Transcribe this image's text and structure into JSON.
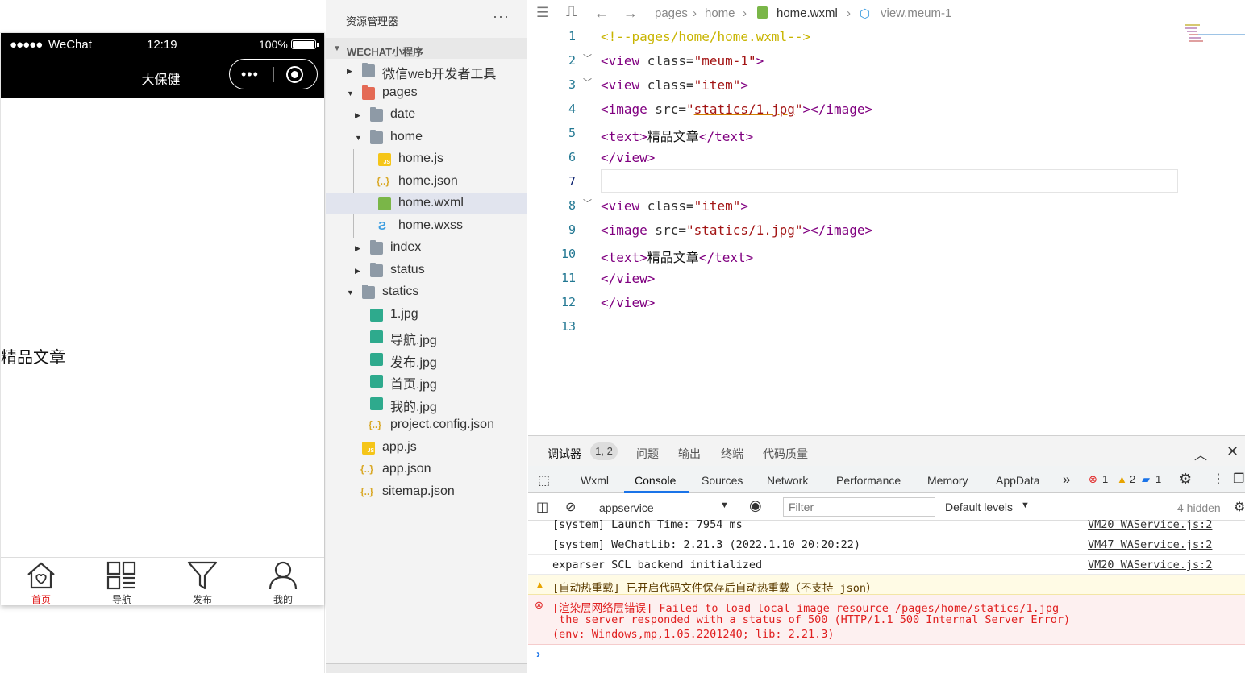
{
  "simulator": {
    "status": {
      "signal": "●●●●●",
      "carrier": "WeChat",
      "time": "12:19",
      "battery": "100%"
    },
    "nav_title": "大保健",
    "capsule_dots": "•••",
    "page_text": "精品文章",
    "tabs": [
      {
        "label": "首页",
        "icon": "home-heart-icon",
        "active": true
      },
      {
        "label": "导航",
        "icon": "grid-icon",
        "active": false
      },
      {
        "label": "发布",
        "icon": "funnel-icon",
        "active": false
      },
      {
        "label": "我的",
        "icon": "user-icon",
        "active": false
      }
    ]
  },
  "explorer": {
    "header": "资源管理器",
    "more": "···",
    "project": "WECHAT小程序",
    "tree": [
      {
        "name": "微信web开发者工具",
        "type": "folder"
      },
      {
        "name": "pages",
        "type": "folder"
      },
      {
        "name": "date",
        "type": "folder"
      },
      {
        "name": "home",
        "type": "folder"
      },
      {
        "name": "home.js",
        "type": "js"
      },
      {
        "name": "home.json",
        "type": "json"
      },
      {
        "name": "home.wxml",
        "type": "wxml"
      },
      {
        "name": "home.wxss",
        "type": "wxss"
      },
      {
        "name": "index",
        "type": "folder"
      },
      {
        "name": "status",
        "type": "folder"
      },
      {
        "name": "statics",
        "type": "folder"
      },
      {
        "name": "1.jpg",
        "type": "image"
      },
      {
        "name": "导航.jpg",
        "type": "image"
      },
      {
        "name": "发布.jpg",
        "type": "image"
      },
      {
        "name": "首页.jpg",
        "type": "image"
      },
      {
        "name": "我的.jpg",
        "type": "image"
      },
      {
        "name": "project.config.json",
        "type": "json"
      },
      {
        "name": "app.js",
        "type": "js"
      },
      {
        "name": "app.json",
        "type": "json"
      },
      {
        "name": "sitemap.json",
        "type": "json"
      }
    ]
  },
  "editor": {
    "breadcrumb": [
      "pages",
      "home",
      "home.wxml",
      "view.meum-1"
    ],
    "line_numbers": [
      "1",
      "2",
      "3",
      "4",
      "5",
      "6",
      "7",
      "8",
      "9",
      "10",
      "11",
      "12",
      "13"
    ],
    "code": {
      "l1": "<!--pages/home/home.wxml-->",
      "view_open": "<view",
      "class_attr": " class=",
      "meum_val": "\"meum-1\"",
      "item_val": "\"item\"",
      "gt": ">",
      "image_open": "<image",
      "src_attr": " src=",
      "q": "\"",
      "img_path": "statics/1.jpg",
      "img_val": "\"statics/1.jpg\"",
      "image_close": "></image>",
      "text_open": "<text>",
      "text_content": "精品文章",
      "text_close": "</text>",
      "view_close": "</view>"
    }
  },
  "devtools": {
    "tabs": [
      "调试器",
      "问题",
      "输出",
      "终端",
      "代码质量"
    ],
    "badge": "1, 2",
    "panels": [
      "Wxml",
      "Console",
      "Sources",
      "Network",
      "Performance",
      "Memory",
      "AppData"
    ],
    "active_panel": "Console",
    "counts": {
      "errors": "1",
      "warnings": "2",
      "info": "1"
    },
    "context": "appservice",
    "filter_placeholder": "Filter",
    "levels": "Default levels",
    "hidden": "4 hidden",
    "logs": [
      {
        "msg": "[system] Launch Time: 7954 ms",
        "src": "VM20 WAService.js:2",
        "level": "log"
      },
      {
        "msg": "[system] WeChatLib: 2.21.3 (2022.1.10 20:20:22)",
        "src": "VM47 WAService.js:2",
        "level": "log"
      },
      {
        "msg": "exparser SCL backend initialized",
        "src": "VM20 WAService.js:2",
        "level": "log"
      },
      {
        "msg": "[自动热重载] 已开启代码文件保存后自动热重载（不支持 json）",
        "src": "",
        "level": "warn"
      },
      {
        "msg": "[渲染层网络层错误] Failed to load local image resource /pages/home/statics/1.jpg",
        "msg2": " the server responded with a status of 500 (HTTP/1.1 500 Internal Server Error)",
        "msg3": "(env: Windows,mp,1.05.2201240; lib: 2.21.3)",
        "src": "",
        "level": "error"
      }
    ],
    "prompt": "›"
  },
  "colors": {
    "accent": "#1a73e8",
    "error": "#e02020",
    "tab_active": "#e02020"
  }
}
